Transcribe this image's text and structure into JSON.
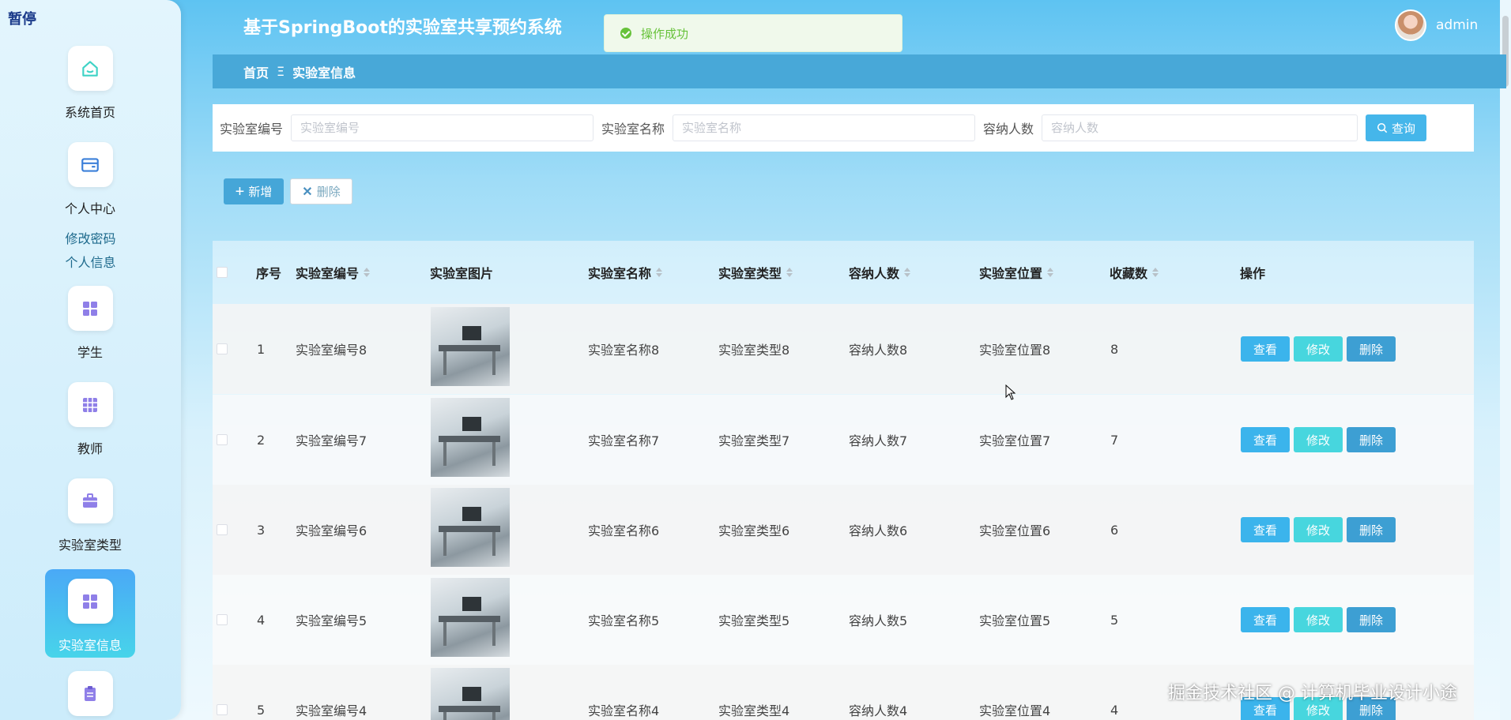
{
  "overlay": {
    "pause_label": "暂停"
  },
  "header": {
    "title": "基于SpringBoot的实验室共享预约系统",
    "username": "admin"
  },
  "toast": {
    "message": "操作成功"
  },
  "sidebar": {
    "items": [
      {
        "label": "系统首页",
        "icon": "home-icon"
      },
      {
        "label": "个人中心",
        "icon": "wallet-icon"
      },
      {
        "label": "学生",
        "icon": "grid-icon"
      },
      {
        "label": "教师",
        "icon": "grid-icon"
      },
      {
        "label": "实验室类型",
        "icon": "briefcase-icon"
      },
      {
        "label": "实验室信息",
        "icon": "grid-icon",
        "active": true
      },
      {
        "label": "",
        "icon": "clipboard-icon"
      }
    ],
    "sub_links": [
      "修改密码",
      "个人信息"
    ]
  },
  "breadcrumb": {
    "home": "首页",
    "separator": "Ξ",
    "current": "实验室信息"
  },
  "search": {
    "fields": [
      {
        "label": "实验室编号",
        "placeholder": "实验室编号"
      },
      {
        "label": "实验室名称",
        "placeholder": "实验室名称"
      },
      {
        "label": "容纳人数",
        "placeholder": "容纳人数"
      }
    ],
    "query_label": "查询"
  },
  "actions": {
    "add_label": "新增",
    "delete_label": "删除"
  },
  "table": {
    "columns": [
      "序号",
      "实验室编号",
      "实验室图片",
      "实验室名称",
      "实验室类型",
      "容纳人数",
      "实验室位置",
      "收藏数",
      "操作"
    ],
    "rows": [
      {
        "index": "1",
        "code": "实验室编号8",
        "name": "实验室名称8",
        "type": "实验室类型8",
        "capacity": "容纳人数8",
        "location": "实验室位置8",
        "favorites": "8"
      },
      {
        "index": "2",
        "code": "实验室编号7",
        "name": "实验室名称7",
        "type": "实验室类型7",
        "capacity": "容纳人数7",
        "location": "实验室位置7",
        "favorites": "7"
      },
      {
        "index": "3",
        "code": "实验室编号6",
        "name": "实验室名称6",
        "type": "实验室类型6",
        "capacity": "容纳人数6",
        "location": "实验室位置6",
        "favorites": "6"
      },
      {
        "index": "4",
        "code": "实验室编号5",
        "name": "实验室名称5",
        "type": "实验室类型5",
        "capacity": "容纳人数5",
        "location": "实验室位置5",
        "favorites": "5"
      },
      {
        "index": "5",
        "code": "实验室编号4",
        "name": "实验室名称4",
        "type": "实验室类型4",
        "capacity": "容纳人数4",
        "location": "实验室位置4",
        "favorites": "4"
      }
    ],
    "row_actions": {
      "view": "查看",
      "edit": "修改",
      "delete": "删除"
    }
  },
  "watermark": "掘金技术社区 @ 计算机毕业设计小途",
  "colors": {
    "accent": "#45b6ea",
    "header_bar": "#48a8d8",
    "success": "#67c23a",
    "edit": "#47d6de"
  }
}
